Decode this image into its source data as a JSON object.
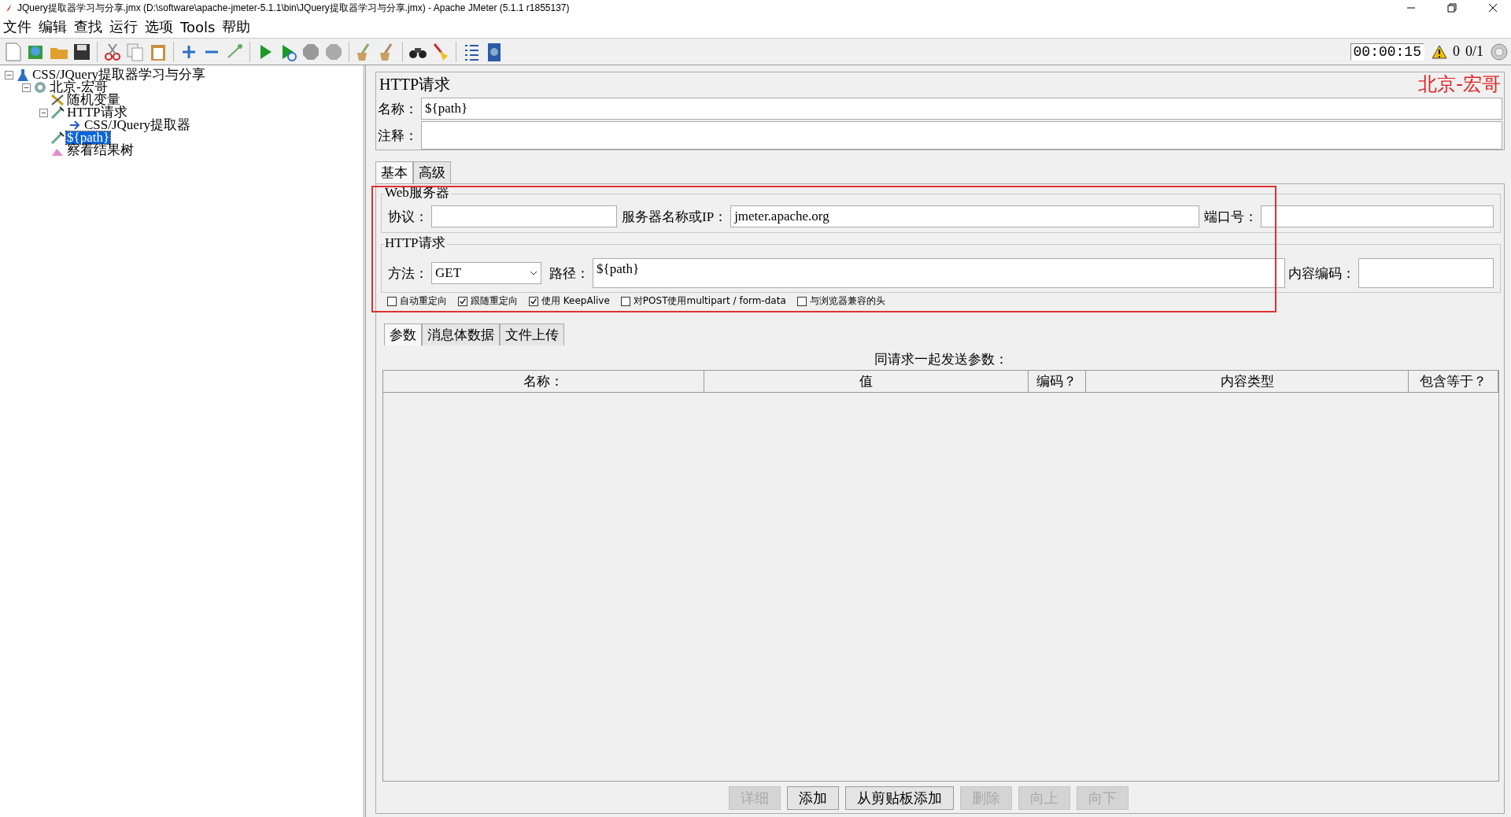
{
  "window": {
    "title": "JQuery提取器学习与分享.jmx (D:\\software\\apache-jmeter-5.1.1\\bin\\JQuery提取器学习与分享.jmx) - Apache JMeter (5.1.1 r1855137)"
  },
  "menu": [
    {
      "label": "文件"
    },
    {
      "label": "编辑"
    },
    {
      "label": "查找"
    },
    {
      "label": "运行"
    },
    {
      "label": "选项"
    },
    {
      "label": "Tools"
    },
    {
      "label": "帮助"
    }
  ],
  "status": {
    "timer": "00:00:15",
    "warnings": "0",
    "threads": "0/1"
  },
  "tree": [
    {
      "label": "CSS/JQuery提取器学习与分享",
      "kind": "plan",
      "expanded": true,
      "selected": false,
      "children": [
        {
          "label": "北京-宏哥",
          "kind": "threads",
          "expanded": true,
          "selected": false,
          "children": [
            {
              "label": "随机变量",
              "kind": "config",
              "selected": false
            },
            {
              "label": "HTTP请求",
              "kind": "sampler",
              "expanded": true,
              "selected": false,
              "children": [
                {
                  "label": "CSS/JQuery提取器",
                  "kind": "extractor",
                  "selected": false
                }
              ]
            },
            {
              "label": "${path}",
              "kind": "sampler",
              "selected": true
            },
            {
              "label": "察看结果树",
              "kind": "listener",
              "selected": false
            }
          ]
        }
      ]
    }
  ],
  "panel": {
    "title": "HTTP请求",
    "annotation": "北京-宏哥",
    "name_label": "名称：",
    "name": "${path}",
    "comment_label": "注释：",
    "tabs": [
      {
        "label": "基本",
        "selected": true
      },
      {
        "label": "高级",
        "selected": false
      }
    ],
    "web_server": {
      "legend": "Web服务器",
      "protocol_label": "协议：",
      "server_label": "服务器名称或IP：",
      "server": "jmeter.apache.org",
      "port_label": "端口号："
    },
    "http_request": {
      "legend": "HTTP请求",
      "method_label": "方法：",
      "method": "GET",
      "path_label": "路径：",
      "path": "${path}",
      "encoding_label": "内容编码："
    },
    "options": [
      {
        "label": "自动重定向",
        "checked": false
      },
      {
        "label": "跟随重定向",
        "checked": true
      },
      {
        "label": "使用 KeepAlive",
        "checked": true
      },
      {
        "label": "对POST使用multipart / form-data",
        "checked": false
      },
      {
        "label": "与浏览器兼容的头",
        "checked": false
      }
    ],
    "sub_tabs": [
      {
        "label": "参数",
        "selected": true
      },
      {
        "label": "消息体数据",
        "selected": false
      },
      {
        "label": "文件上传",
        "selected": false
      }
    ],
    "params": {
      "caption": "同请求一起发送参数：",
      "columns": [
        "名称：",
        "值",
        "编码？",
        "内容类型",
        "包含等于？"
      ]
    },
    "buttons": [
      {
        "label": "详细",
        "disabled": true
      },
      {
        "label": "添加",
        "disabled": false
      },
      {
        "label": "从剪贴板添加",
        "disabled": false
      },
      {
        "label": "删除",
        "disabled": true
      },
      {
        "label": "向上",
        "disabled": true
      },
      {
        "label": "向下",
        "disabled": true
      }
    ]
  }
}
